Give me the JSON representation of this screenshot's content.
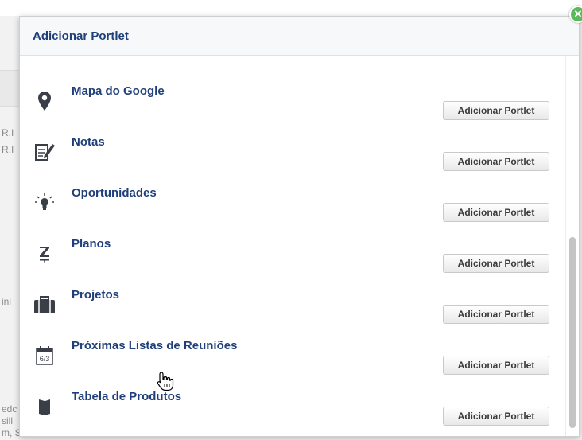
{
  "background": {
    "left_fragments": [
      "R.I",
      "R.I",
      "ini",
      "edc",
      "sill",
      "m, SP"
    ]
  },
  "modal": {
    "title": "Adicionar Portlet",
    "close_glyph": "✕",
    "items": [
      {
        "label": "Mapa do Google",
        "icon": "map-pin-icon",
        "button": "Adicionar Portlet"
      },
      {
        "label": "Notas",
        "icon": "note-edit-icon",
        "button": "Adicionar Portlet"
      },
      {
        "label": "Oportunidades",
        "icon": "lightbulb-icon",
        "button": "Adicionar Portlet"
      },
      {
        "label": "Planos",
        "icon": "plans-icon",
        "button": "Adicionar Portlet"
      },
      {
        "label": "Projetos",
        "icon": "briefcase-icon",
        "button": "Adicionar Portlet"
      },
      {
        "label": "Próximas Listas de Reuniões",
        "icon": "calendar-icon",
        "button": "Adicionar Portlet",
        "icon_text": "6/3"
      },
      {
        "label": "Tabela de Produtos",
        "icon": "book-icon",
        "button": "Adicionar Portlet"
      }
    ]
  },
  "colors": {
    "title": "#1f3f7a",
    "close": "#5cb85c",
    "icon": "#3a3f47"
  }
}
